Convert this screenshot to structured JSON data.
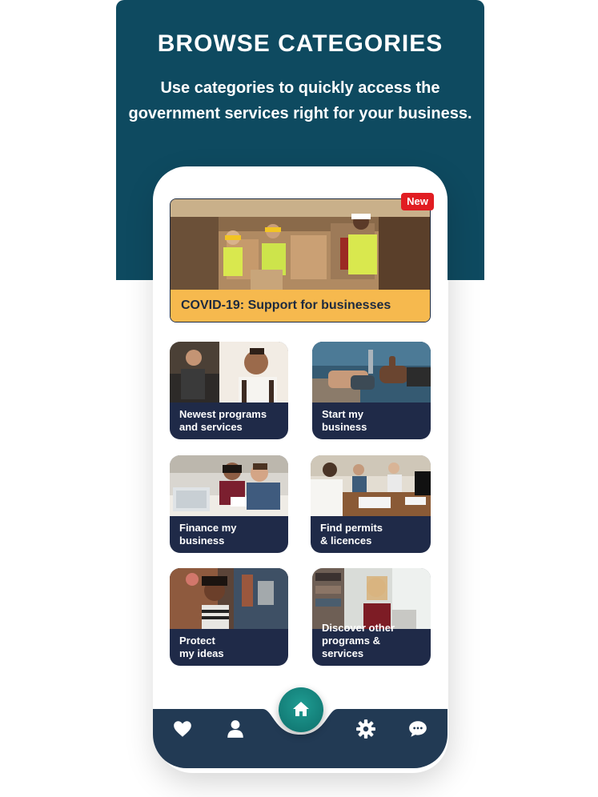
{
  "header": {
    "title": "BROWSE CATEGORIES",
    "subtitle": "Use categories to quickly access the government services right for your business."
  },
  "featured": {
    "badge": "New",
    "label": "COVID-19: Support for businesses"
  },
  "categories": [
    {
      "label": "Newest programs\nand services"
    },
    {
      "label": "Start my\nbusiness"
    },
    {
      "label": "Finance my\nbusiness"
    },
    {
      "label": "Find permits\n& licences"
    },
    {
      "label": "Protect\nmy ideas"
    },
    {
      "label": "Discover other\nprograms & services"
    }
  ],
  "nav": {
    "items": [
      "heart-icon",
      "user-icon",
      "home-icon",
      "gear-icon",
      "chat-icon"
    ]
  },
  "colors": {
    "banner": "#0e4a60",
    "card": "#1f2a48",
    "featured_caption": "#f6b94e",
    "badge": "#e11d22",
    "navbar": "#223a54",
    "home_button": "#138579"
  }
}
